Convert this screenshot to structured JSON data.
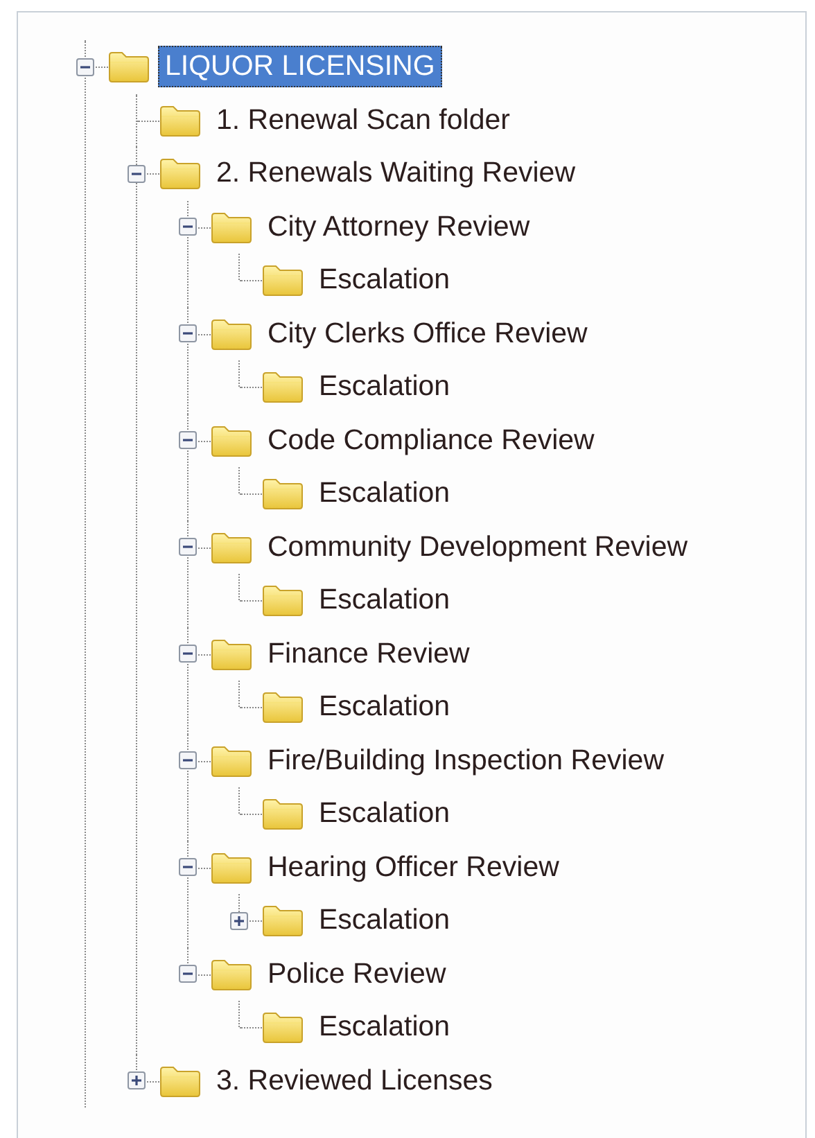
{
  "tree": [
    {
      "label": "LIQUOR LICENSING",
      "selected": true,
      "expanded": true,
      "children": [
        {
          "label": "1. Renewal Scan folder",
          "selected": false
        },
        {
          "label": "2. Renewals Waiting Review",
          "selected": false,
          "expanded": true,
          "children": [
            {
              "label": "City Attorney Review",
              "selected": false,
              "expanded": true,
              "children": [
                {
                  "label": "Escalation",
                  "selected": false
                }
              ]
            },
            {
              "label": "City Clerks Office Review",
              "selected": false,
              "expanded": true,
              "children": [
                {
                  "label": "Escalation",
                  "selected": false
                }
              ]
            },
            {
              "label": "Code Compliance Review",
              "selected": false,
              "expanded": true,
              "children": [
                {
                  "label": "Escalation",
                  "selected": false
                }
              ]
            },
            {
              "label": "Community Development Review",
              "selected": false,
              "expanded": true,
              "children": [
                {
                  "label": "Escalation",
                  "selected": false
                }
              ]
            },
            {
              "label": "Finance Review",
              "selected": false,
              "expanded": true,
              "children": [
                {
                  "label": "Escalation",
                  "selected": false
                }
              ]
            },
            {
              "label": "Fire/Building Inspection Review",
              "selected": false,
              "expanded": true,
              "children": [
                {
                  "label": "Escalation",
                  "selected": false
                }
              ]
            },
            {
              "label": "Hearing Officer Review",
              "selected": false,
              "expanded": true,
              "children": [
                {
                  "label": "Escalation",
                  "selected": false,
                  "expanded": false
                }
              ]
            },
            {
              "label": "Police Review",
              "selected": false,
              "expanded": true,
              "children": [
                {
                  "label": "Escalation",
                  "selected": false
                }
              ]
            }
          ]
        },
        {
          "label": "3. Reviewed Licenses",
          "selected": false,
          "expanded": false
        }
      ]
    }
  ]
}
